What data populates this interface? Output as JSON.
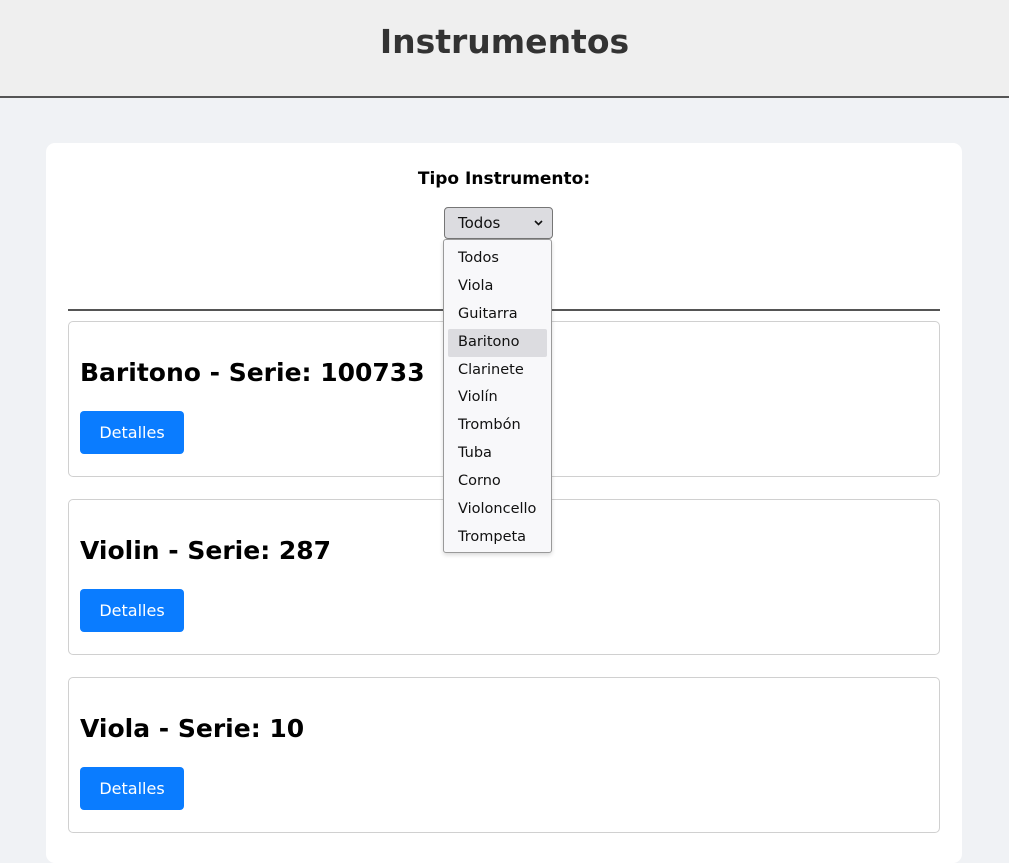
{
  "header": {
    "title": "Instrumentos"
  },
  "filter": {
    "label": "Tipo Instrumento:",
    "selected": "Todos",
    "highlighted": "Baritono",
    "options": [
      "Todos",
      "Viola",
      "Guitarra",
      "Baritono",
      "Clarinete",
      "Violín",
      "Trombón",
      "Tuba",
      "Corno",
      "Violoncello",
      "Trompeta"
    ]
  },
  "cards": [
    {
      "title": "Baritono - Serie: 100733",
      "button": "Detalles"
    },
    {
      "title": "Violin - Serie: 287",
      "button": "Detalles"
    },
    {
      "title": "Viola - Serie: 10",
      "button": "Detalles"
    }
  ],
  "colors": {
    "button": "#0a7cff",
    "header_bg": "#efefef",
    "page_bg": "#f0f2f5"
  }
}
